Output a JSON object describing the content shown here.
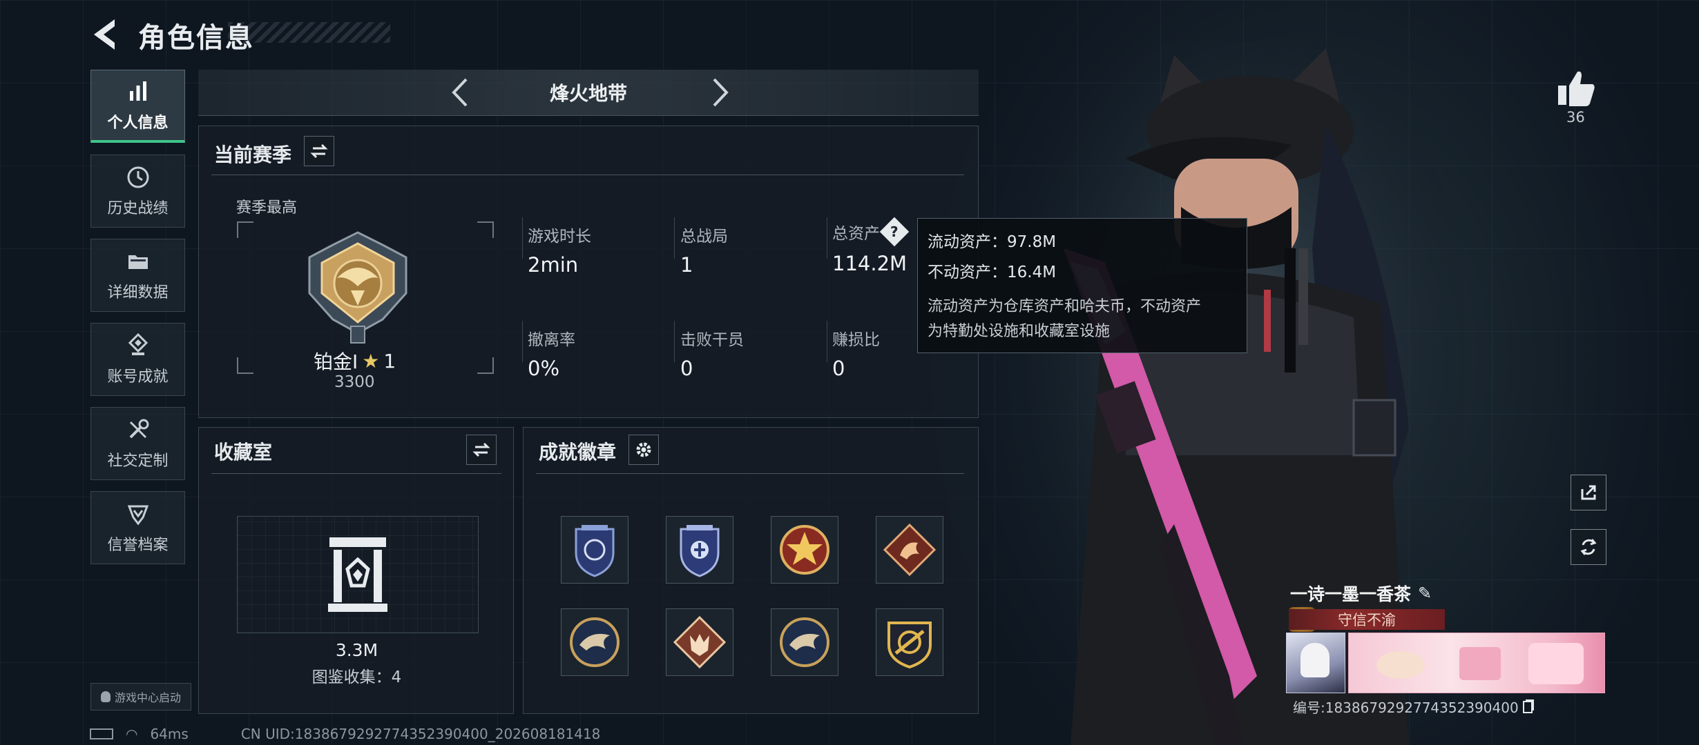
{
  "header": {
    "title": "角色信息"
  },
  "sidebar": {
    "items": [
      {
        "label": "个人信息",
        "icon": "bar-chart-icon"
      },
      {
        "label": "历史战绩",
        "icon": "history-icon"
      },
      {
        "label": "详细数据",
        "icon": "folder-icon"
      },
      {
        "label": "账号成就",
        "icon": "achievement-icon"
      },
      {
        "label": "社交定制",
        "icon": "tools-icon"
      },
      {
        "label": "信誉档案",
        "icon": "credit-icon"
      }
    ],
    "launch_label": "游戏中心启动"
  },
  "mode": {
    "title": "烽火地带"
  },
  "season": {
    "title": "当前赛季",
    "best_label": "赛季最高",
    "rank_name": "铂金I",
    "rank_stars": "1",
    "rank_score": "3300",
    "stats": [
      {
        "label": "游戏时长",
        "value": "2min"
      },
      {
        "label": "总战局",
        "value": "1"
      },
      {
        "label": "总资产",
        "value": "114.2M"
      },
      {
        "label": "撤离率",
        "value": "0%"
      },
      {
        "label": "击败干员",
        "value": "0"
      },
      {
        "label": "赚损比",
        "value": "0"
      }
    ]
  },
  "tooltip": {
    "liquid": "流动资产：97.8M",
    "fixed": "不动资产：16.4M",
    "note_line1": "流动资产为仓库资产和哈夫币，不动资产",
    "note_line2": "为特勤处设施和收藏室设施"
  },
  "collection": {
    "title": "收藏室",
    "value": "3.3M",
    "catalog": "图鉴收集：4"
  },
  "badges": {
    "title": "成就徽章"
  },
  "player": {
    "name": "一诗一墨一香茶",
    "credit": "守信不渝",
    "uid": "编号:1838679292774352390400",
    "likes": "36"
  },
  "footer": {
    "ping": "64ms",
    "cn_uid": "CN UID:1838679292774352390400_202608181418"
  },
  "colors": {
    "accent": "#3ec58b",
    "panel": "#161e26",
    "credit": "#8a2a2a"
  }
}
